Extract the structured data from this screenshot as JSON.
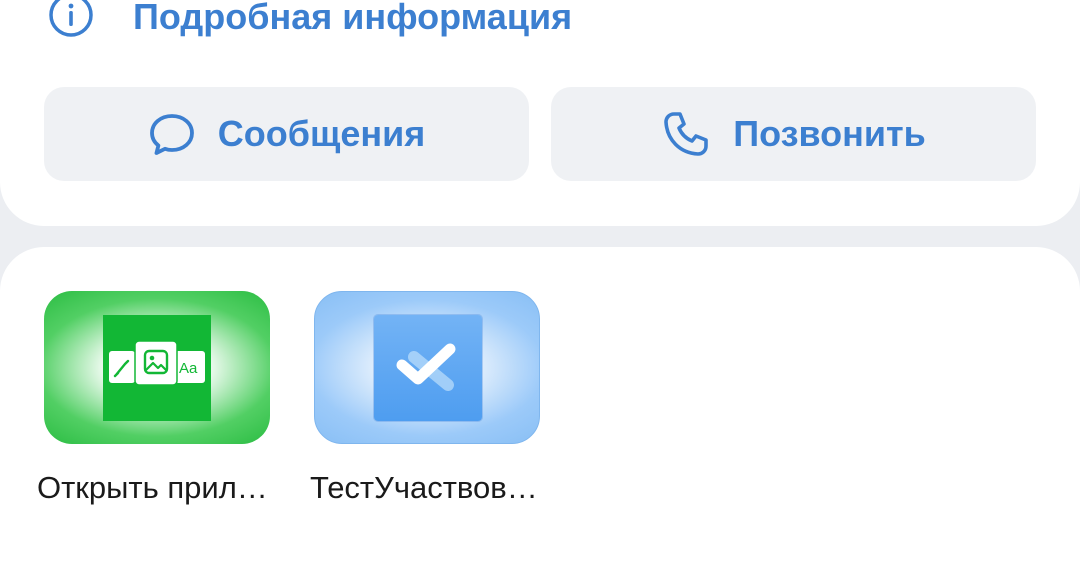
{
  "details": {
    "label": "Подробная информация",
    "icon": "info-icon"
  },
  "actions": [
    {
      "label": "Сообщения",
      "icon": "message-bubble-icon"
    },
    {
      "label": "Позвонить",
      "icon": "phone-icon"
    }
  ],
  "apps": [
    {
      "label": "Открыть прил…",
      "icon": "image-edit-app-icon"
    },
    {
      "label": "ТестУчаствов…",
      "icon": "checkmark-app-icon"
    }
  ],
  "colors": {
    "accent": "#3c7fd0",
    "button_bg": "#eff1f4",
    "background": "#eceef2",
    "card": "#ffffff",
    "green_app": "#12b735",
    "blue_app": "#4e9df0"
  }
}
